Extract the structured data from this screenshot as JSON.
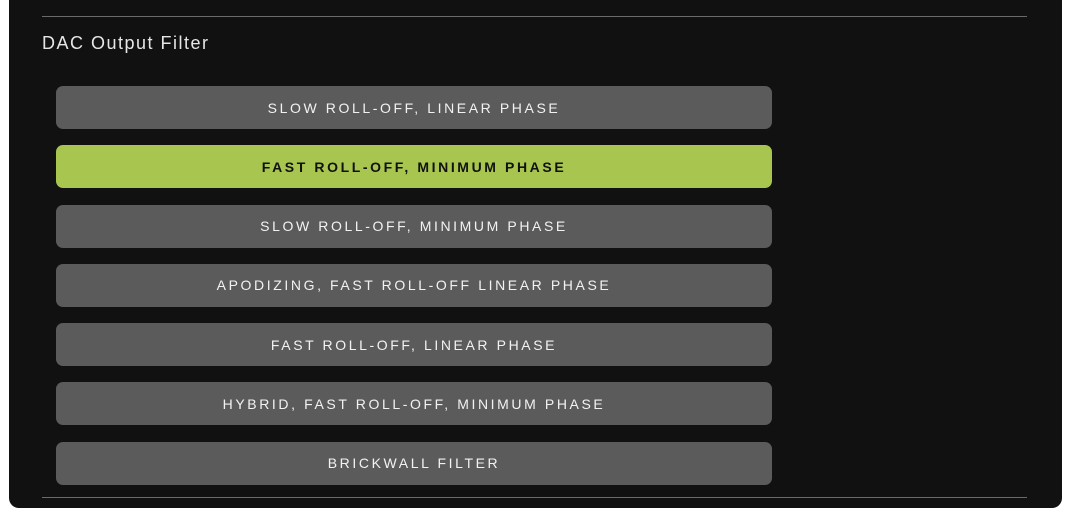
{
  "panel": {
    "title": "DAC Output Filter",
    "accent_color": "#a8c64f",
    "button_color": "#5b5b5b",
    "background_color": "#111111"
  },
  "filters": [
    {
      "label": "SLOW ROLL-OFF, LINEAR PHASE",
      "selected": false
    },
    {
      "label": "FAST ROLL-OFF, MINIMUM PHASE",
      "selected": true
    },
    {
      "label": "SLOW ROLL-OFF, MINIMUM PHASE",
      "selected": false
    },
    {
      "label": "APODIZING, FAST ROLL-OFF LINEAR PHASE",
      "selected": false
    },
    {
      "label": "FAST ROLL-OFF, LINEAR PHASE",
      "selected": false
    },
    {
      "label": "HYBRID, FAST ROLL-OFF, MINIMUM PHASE",
      "selected": false
    },
    {
      "label": "BRICKWALL FILTER",
      "selected": false
    }
  ]
}
